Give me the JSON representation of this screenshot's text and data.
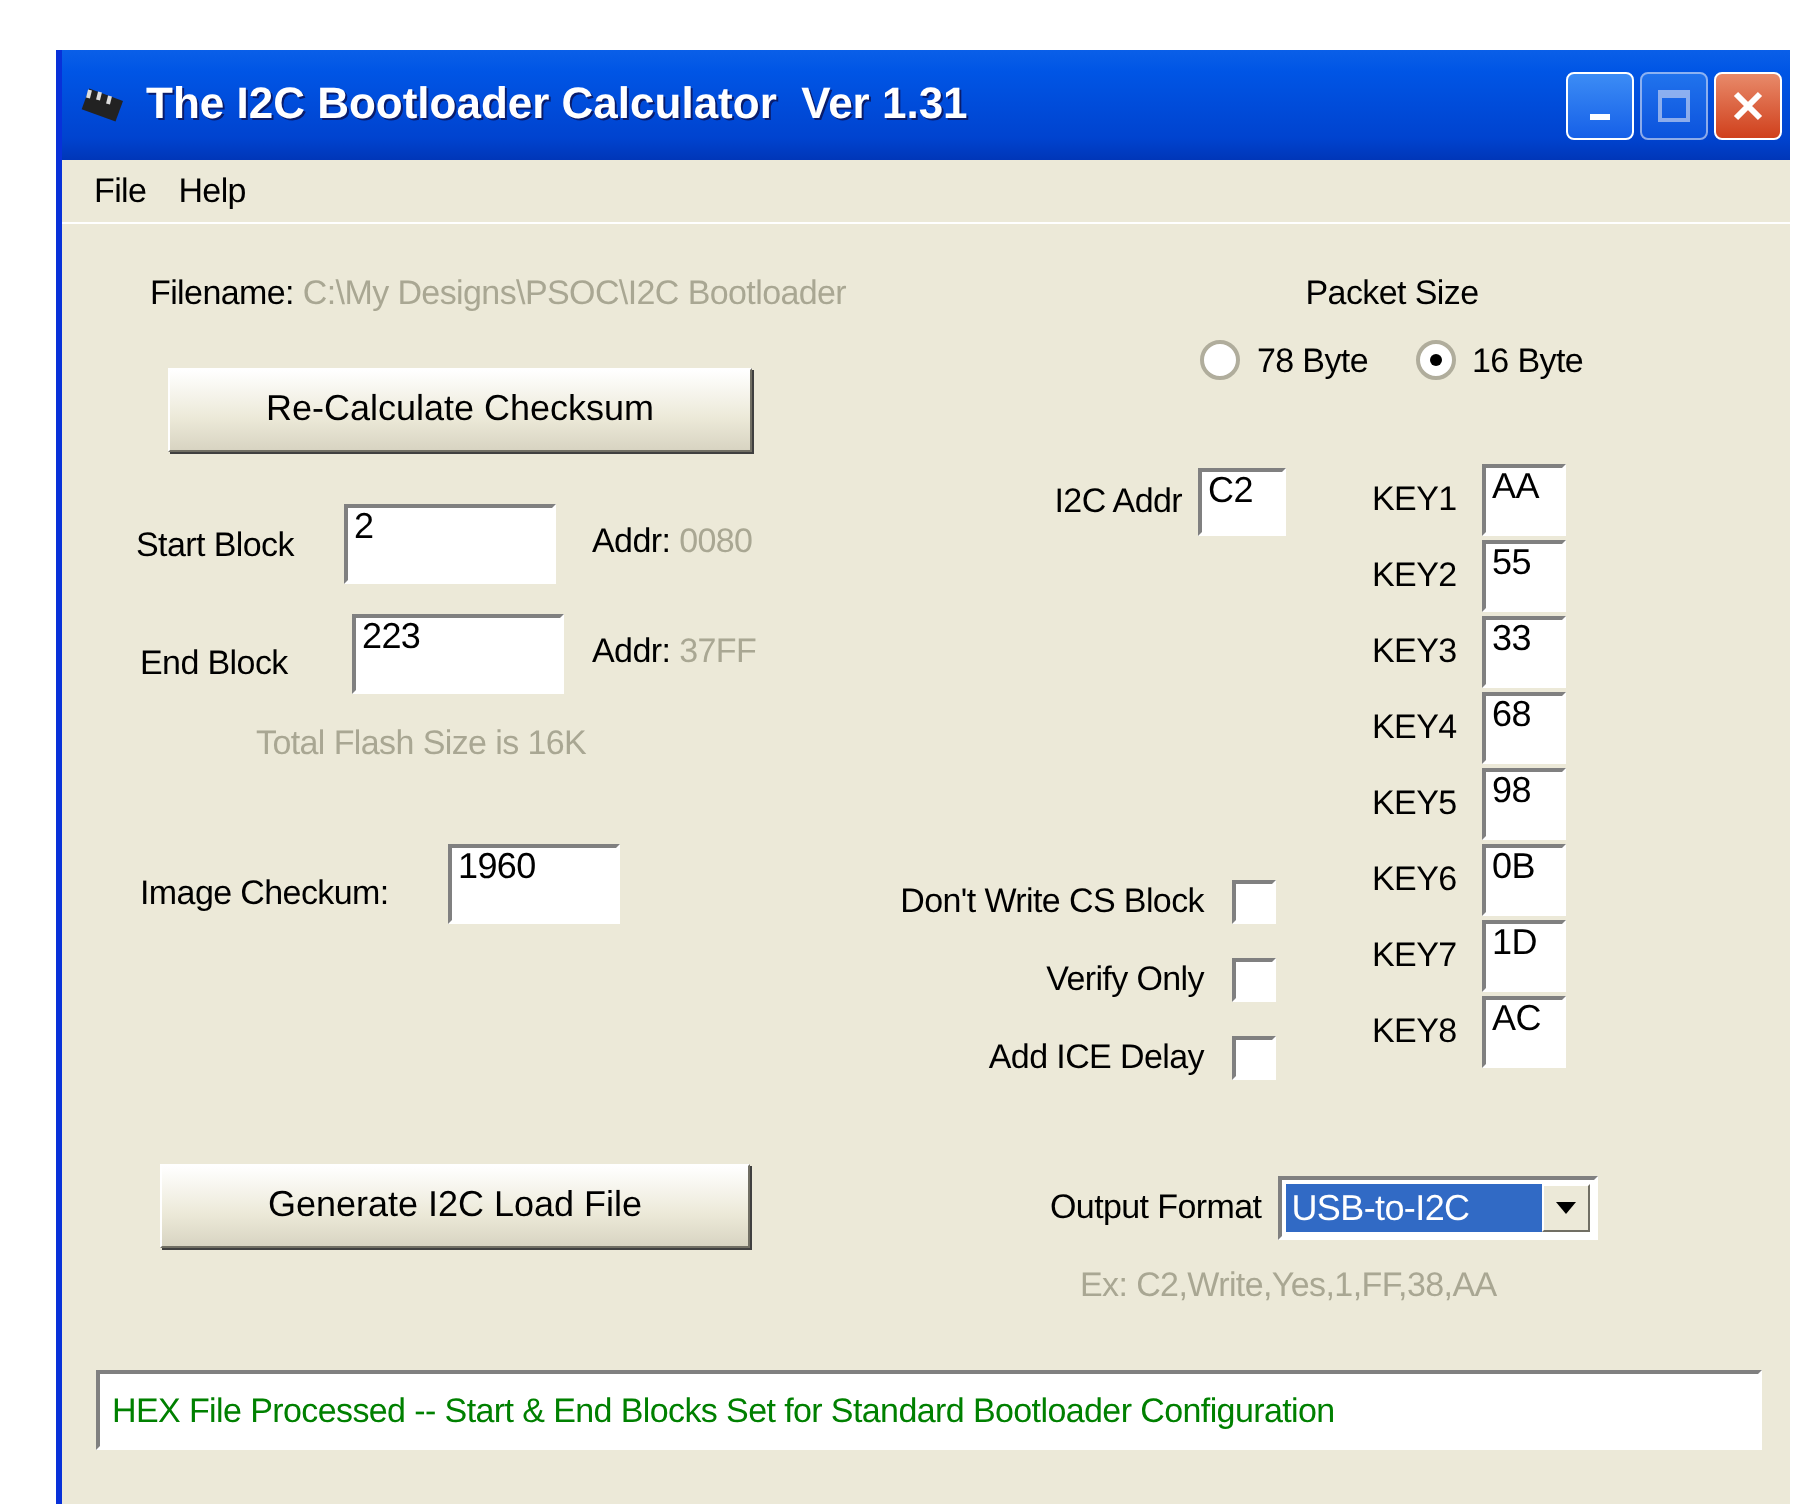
{
  "window": {
    "title": "The I2C Bootloader Calculator  Ver 1.31"
  },
  "menu": [
    {
      "label": "File"
    },
    {
      "label": "Help"
    }
  ],
  "filename": {
    "label": "Filename:",
    "value": "C:\\My Designs\\PSOC\\I2C Bootloader"
  },
  "packet_size": {
    "label": "Packet Size",
    "options": [
      {
        "label": "78 Byte",
        "selected": false
      },
      {
        "label": "16 Byte",
        "selected": true
      }
    ]
  },
  "recalculate_button": "Re-Calculate Checksum",
  "start_block": {
    "label": "Start Block",
    "value": "2",
    "addr_label": "Addr:",
    "addr": "0080"
  },
  "end_block": {
    "label": "End Block",
    "value": "223",
    "addr_label": "Addr:",
    "addr": "37FF"
  },
  "flash_size": "Total Flash Size is 16K",
  "image_checksum": {
    "label": "Image Checkum:",
    "value": "1960"
  },
  "i2c_addr": {
    "label": "I2C Addr",
    "value": "C2"
  },
  "options": [
    {
      "label": "Don't Write CS Block",
      "checked": false
    },
    {
      "label": "Verify Only",
      "checked": false
    },
    {
      "label": "Add ICE Delay",
      "checked": false
    }
  ],
  "keys": [
    {
      "label": "KEY1",
      "value": "AA"
    },
    {
      "label": "KEY2",
      "value": "55"
    },
    {
      "label": "KEY3",
      "value": "33"
    },
    {
      "label": "KEY4",
      "value": "68"
    },
    {
      "label": "KEY5",
      "value": "98"
    },
    {
      "label": "KEY6",
      "value": "0B"
    },
    {
      "label": "KEY7",
      "value": "1D"
    },
    {
      "label": "KEY8",
      "value": "AC"
    }
  ],
  "generate_button": "Generate I2C Load File",
  "output_format": {
    "label": "Output Format",
    "value": "USB-to-I2C",
    "example": "Ex: C2,Write,Yes,1,FF,38,AA"
  },
  "status": "HEX File Processed -- Start & End Blocks Set for Standard Bootloader Configuration"
}
